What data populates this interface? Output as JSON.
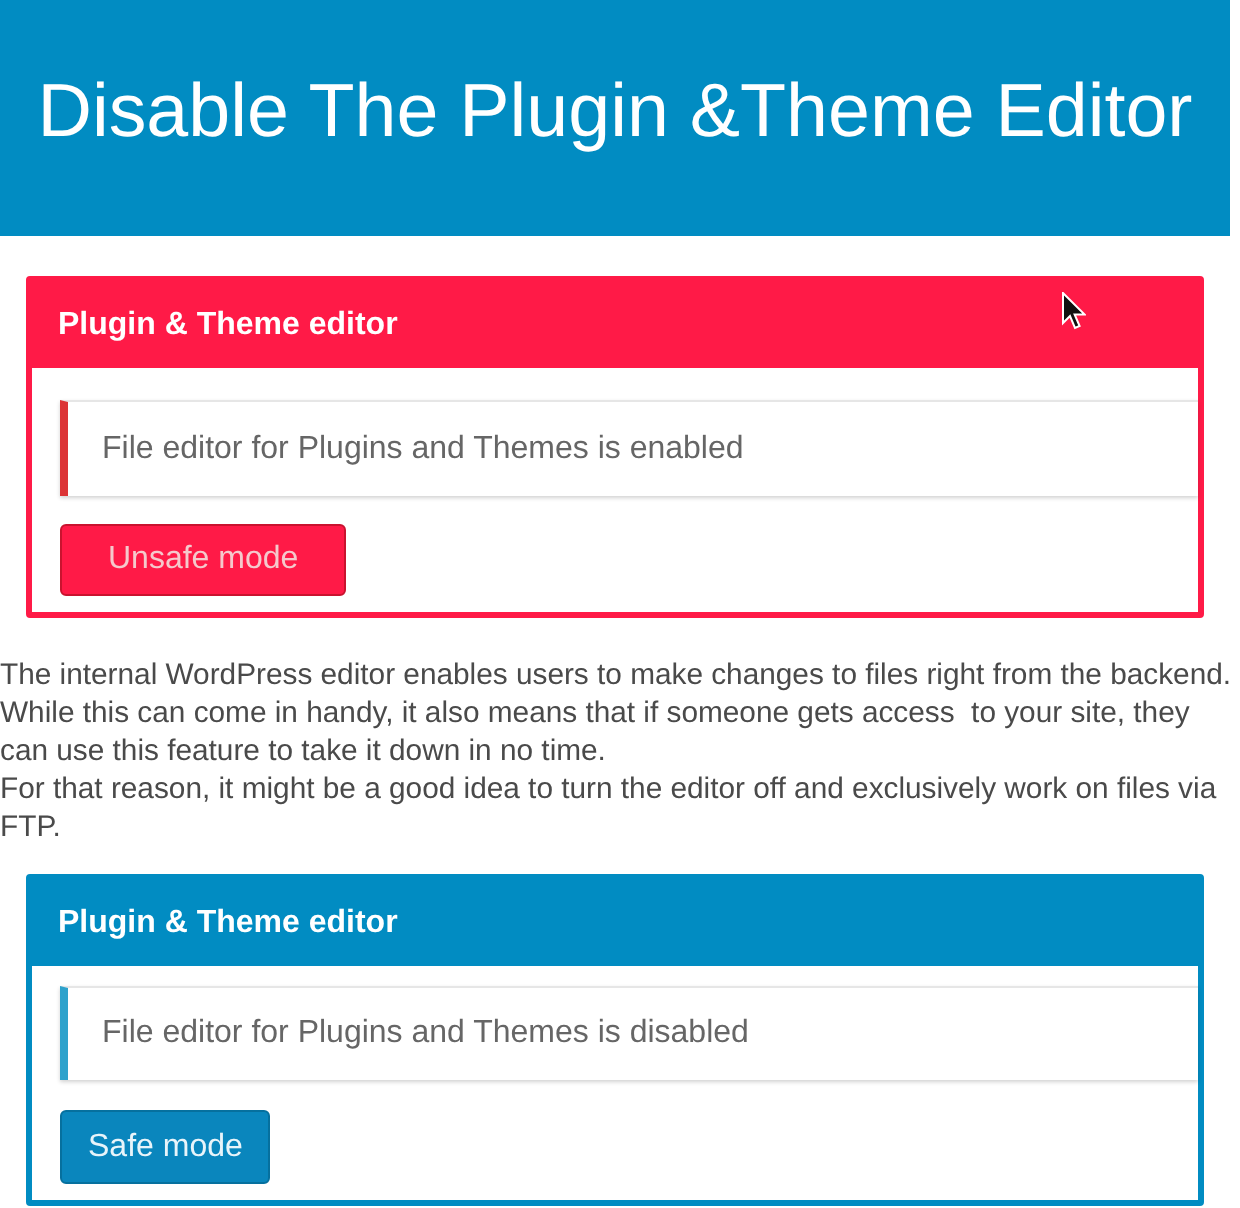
{
  "banner": {
    "title": "Disable The Plugin &Theme Editor"
  },
  "sections": [
    {
      "kind": "unsafe-panel",
      "title": "Plugin & Theme editor",
      "notice": "File editor for Plugins and Themes is enabled",
      "button": "Unsafe mode"
    },
    {
      "kind": "text",
      "paragraphs": [
        "The internal WordPress editor enables users to make changes to files right from the backend. While this can come in handy, it also means that if someone gets access  to your site, they can use this feature to take it down in no time.",
        "For that reason, it might be a good idea to turn the editor off and exclusively work on files via FTP."
      ]
    },
    {
      "kind": "safe-panel",
      "title": "Plugin & Theme editor",
      "notice": "File editor for Plugins and Themes is disabled",
      "button": "Safe mode"
    }
  ]
}
